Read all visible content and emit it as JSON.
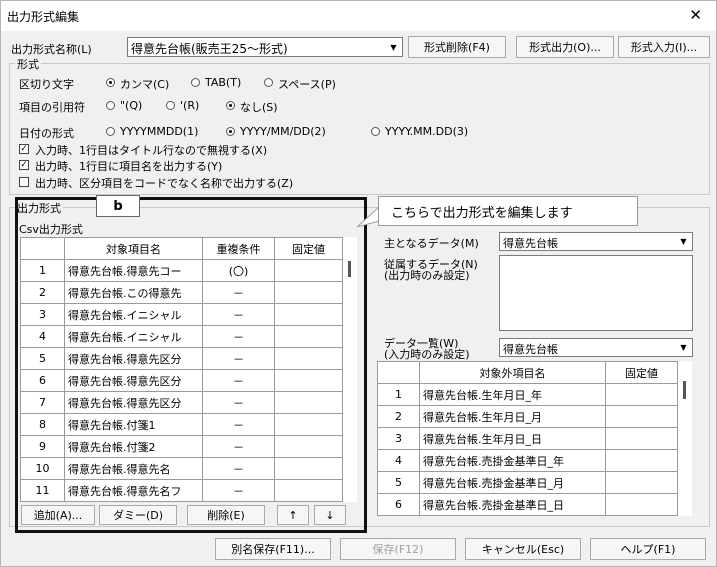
{
  "window": {
    "title": "出力形式編集",
    "close": "✕"
  },
  "format_name": {
    "label": "出力形式名称(L)",
    "value": "得意先台帳(販売王25～形式)"
  },
  "top_buttons": {
    "delete": "形式削除(F4)",
    "export": "形式出力(O)...",
    "import": "形式入力(I)..."
  },
  "format_group": {
    "legend": "形式",
    "delimiter": {
      "label": "区切り文字",
      "options": [
        "カンマ(C)",
        "TAB(T)",
        "スペース(P)"
      ],
      "selected": 0
    },
    "quote": {
      "label": "項目の引用符",
      "options": [
        "\"(Q)",
        "'(R)",
        "なし(S)"
      ],
      "selected": 2
    },
    "date": {
      "label": "日付の形式",
      "options": [
        "YYYYMMDD(1)",
        "YYYY/MM/DD(2)",
        "YYYY.MM.DD(3)"
      ],
      "selected": 1
    },
    "checks": [
      {
        "label": "入力時、1行目はタイトル行なので無視する(X)",
        "checked": true
      },
      {
        "label": "出力時、1行目に項目名を出力する(Y)",
        "checked": true
      },
      {
        "label": "出力時、区分項目をコードでなく名称で出力する(Z)",
        "checked": false
      }
    ]
  },
  "output_group": {
    "legend": "出力形式",
    "subtitle": "Csv出力形式",
    "headers": [
      "",
      "対象項目名",
      "重複条件",
      "固定値"
    ],
    "rows": [
      {
        "no": "1",
        "name": "得意先台帳.得意先コー",
        "dup": "(〇)",
        "fixed": ""
      },
      {
        "no": "2",
        "name": "得意先台帳.この得意先",
        "dup": "－",
        "fixed": ""
      },
      {
        "no": "3",
        "name": "得意先台帳.イニシャル",
        "dup": "－",
        "fixed": ""
      },
      {
        "no": "4",
        "name": "得意先台帳.イニシャル",
        "dup": "－",
        "fixed": ""
      },
      {
        "no": "5",
        "name": "得意先台帳.得意先区分",
        "dup": "－",
        "fixed": ""
      },
      {
        "no": "6",
        "name": "得意先台帳.得意先区分",
        "dup": "－",
        "fixed": ""
      },
      {
        "no": "7",
        "name": "得意先台帳.得意先区分",
        "dup": "－",
        "fixed": ""
      },
      {
        "no": "8",
        "name": "得意先台帳.付箋1",
        "dup": "－",
        "fixed": ""
      },
      {
        "no": "9",
        "name": "得意先台帳.付箋2",
        "dup": "－",
        "fixed": ""
      },
      {
        "no": "10",
        "name": "得意先台帳.得意先名",
        "dup": "－",
        "fixed": ""
      },
      {
        "no": "11",
        "name": "得意先台帳.得意先名フ",
        "dup": "－",
        "fixed": ""
      }
    ],
    "buttons": {
      "add": "追加(A)...",
      "dummy": "ダミー(D)",
      "remove": "削除(E)",
      "up": "↑",
      "down": "↓"
    }
  },
  "callout": {
    "badge": "b",
    "text": "こちらで出力形式を編集します"
  },
  "right_panel": {
    "main_data": {
      "label": "主となるデータ(M)",
      "value": "得意先台帳"
    },
    "sub_data": {
      "label": "従属するデータ(N)",
      "note": "(出力時のみ設定)"
    },
    "data_list": {
      "label": "データ一覧(W)",
      "note": "(入力時のみ設定)",
      "value": "得意先台帳"
    },
    "headers": [
      "",
      "対象外項目名",
      "固定値"
    ],
    "rows": [
      {
        "no": "1",
        "name": "得意先台帳.生年月日_年",
        "fixed": ""
      },
      {
        "no": "2",
        "name": "得意先台帳.生年月日_月",
        "fixed": ""
      },
      {
        "no": "3",
        "name": "得意先台帳.生年月日_日",
        "fixed": ""
      },
      {
        "no": "4",
        "name": "得意先台帳.売掛金基準日_年",
        "fixed": ""
      },
      {
        "no": "5",
        "name": "得意先台帳.売掛金基準日_月",
        "fixed": ""
      },
      {
        "no": "6",
        "name": "得意先台帳.売掛金基準日_日",
        "fixed": ""
      }
    ]
  },
  "bottom_buttons": {
    "save_as": "別名保存(F11)...",
    "save": "保存(F12)",
    "cancel": "キャンセル(Esc)",
    "help": "ヘルプ(F1)"
  }
}
